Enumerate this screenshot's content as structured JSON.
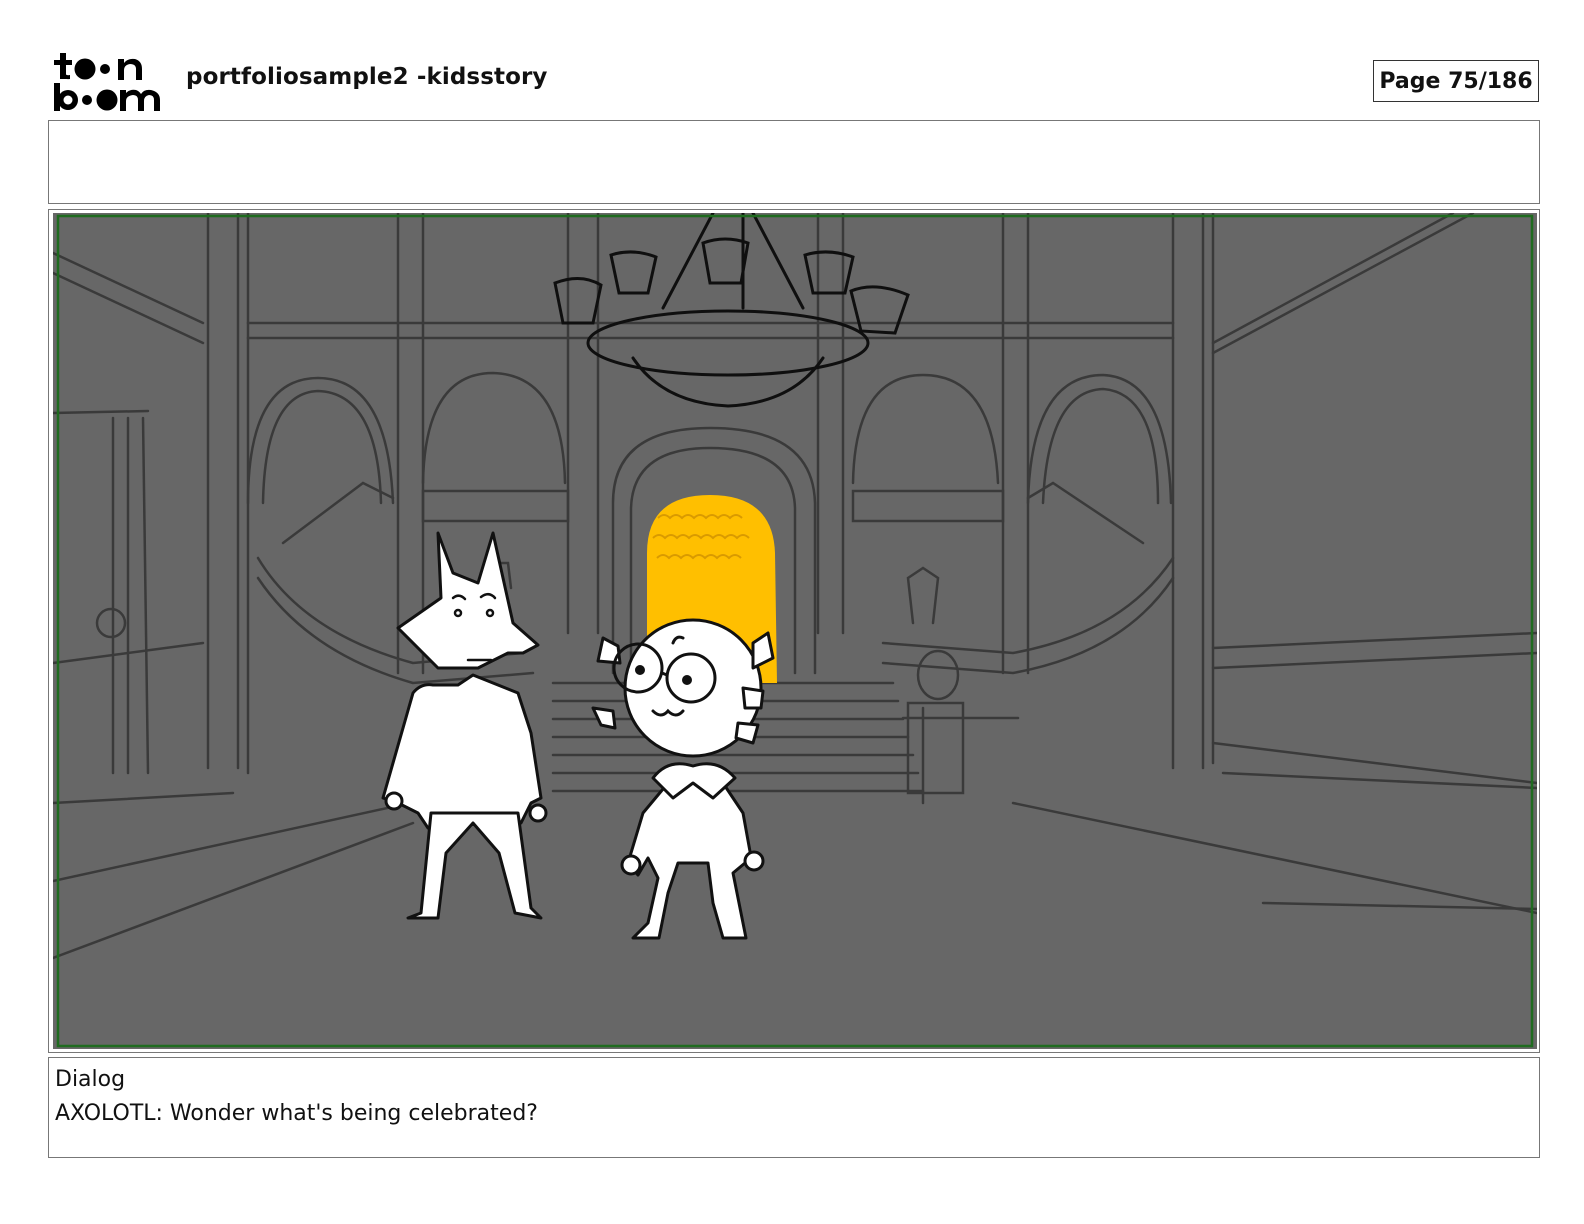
{
  "header": {
    "logo_text": "toonboom",
    "project_title": "portfoliosample2 -kidsstory",
    "page_label": "Page",
    "page_number": "75/186"
  },
  "panel": {
    "background_color": "#676767",
    "safe_frame_color": "#1f6b1f",
    "doorway_color": "#ffbf00"
  },
  "dialog": {
    "heading": "Dialog",
    "line": "AXOLOTL: Wonder what's being celebrated?"
  }
}
